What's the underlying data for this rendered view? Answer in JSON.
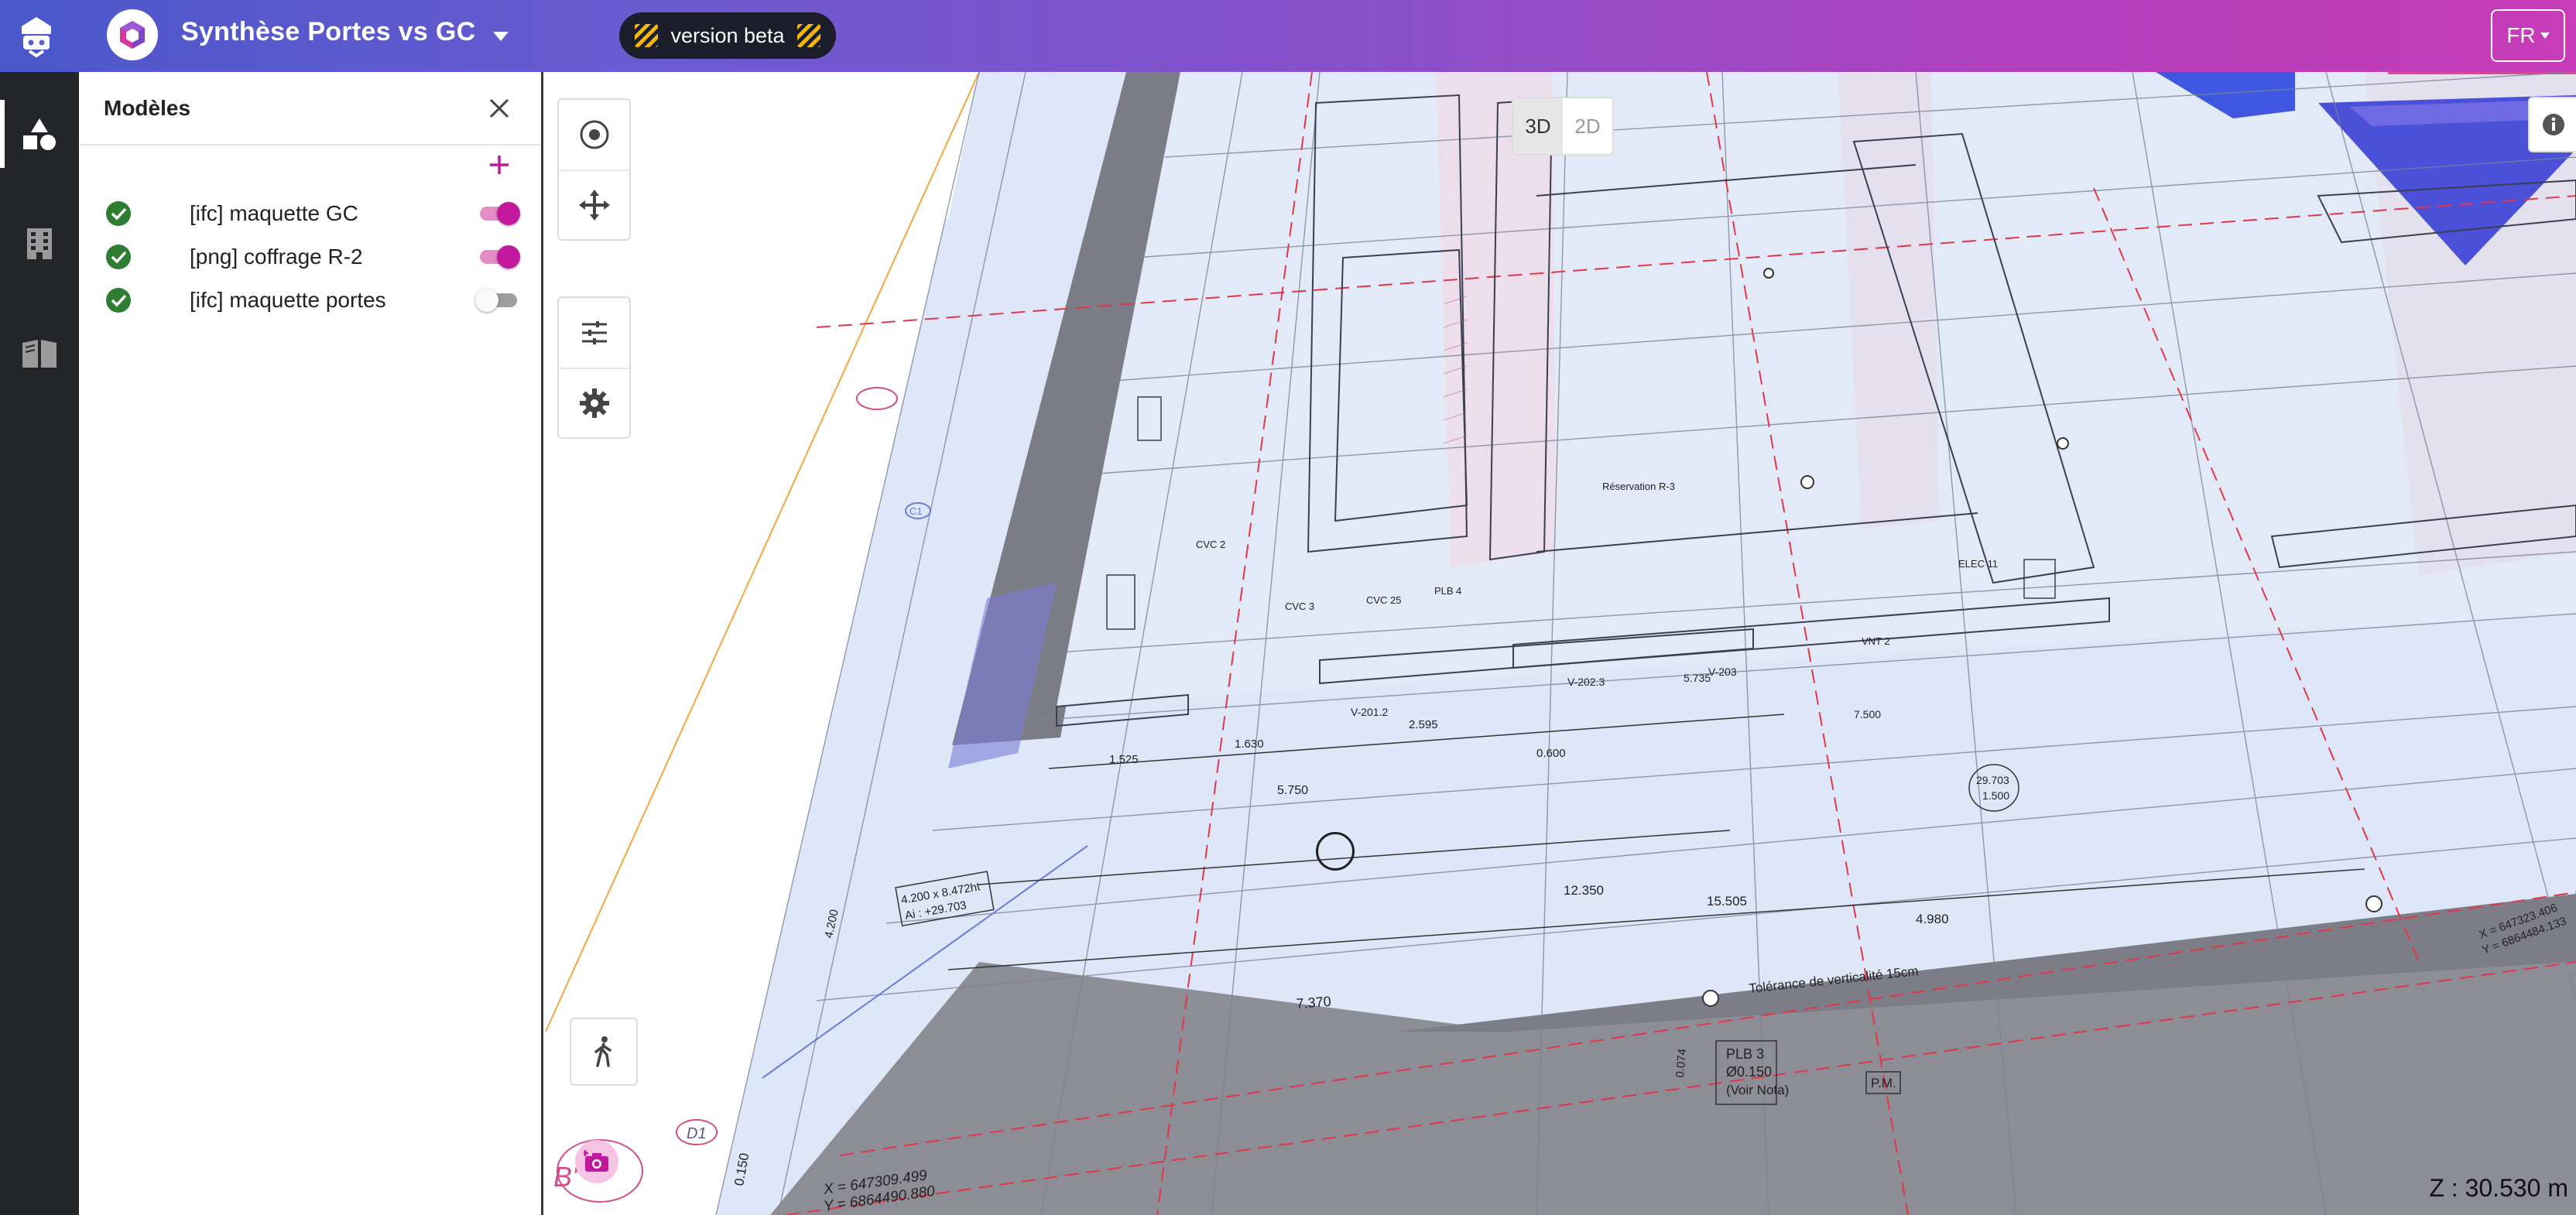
{
  "header": {
    "project_title": "Synthèse Portes vs GC",
    "beta_label": "version beta",
    "language": "FR"
  },
  "panel": {
    "title": "Modèles",
    "models": [
      {
        "label": "[ifc] maquette GC",
        "visible": true,
        "status": "loaded"
      },
      {
        "label": "[png] coffrage R-2",
        "visible": true,
        "status": "loaded"
      },
      {
        "label": "[ifc] maquette portes",
        "visible": false,
        "status": "loaded"
      }
    ]
  },
  "viewer": {
    "mode_3d": "3D",
    "mode_2d": "2D",
    "active_mode": "3D",
    "z_readout": "Z : 30.530 m"
  },
  "plan_labels": {
    "tolerance": "Tolérance de verticalité 15cm",
    "plb3": "PLB 3",
    "plb3_dia": "Ø0.150",
    "plb3_note": "(Voir Nota)",
    "pm": "P.M.",
    "coord_x": "X = 647309.499",
    "coord_y": "Y = 6864490.880",
    "coord_x2": "X = 647323.406",
    "coord_y2": "Y = 6864484.133",
    "axis_d1": "D1",
    "axis_b": "B'",
    "axis_c1": "C1",
    "dim_7370": "7.370",
    "dim_12350": "12.350",
    "dim_15505": "15.505",
    "dim_4980": "4.980",
    "dim_5750": "5.750",
    "dim_1525": "1.525",
    "dim_1630": "1.630",
    "dim_0600": "0.600",
    "dim_2595": "2.595",
    "dim_7500": "7.500",
    "dim_5735": "5.735",
    "dim_4200": "4.200",
    "dim_0150": "0.150",
    "dim_0074": "0.074",
    "spot_level": "29.703",
    "spot_level2": "1.500",
    "v2012": "V-201.2",
    "v2023": "V-202.3",
    "v203": "V-203",
    "cvc2": "CVC 2",
    "cvc3": "CVC 3",
    "cvc25": "CVC 25",
    "plb4": "PLB 4",
    "vnt2": "VNT 2",
    "elec11": "ELEC 11",
    "reservation": "Réservation R-3",
    "lintel": "4.200 x 8.472ht",
    "lintel_ai": "Ai : +29.703"
  },
  "colors": {
    "accent": "#c2189b",
    "check": "#2e7d32",
    "rail_bg": "#242529",
    "header_gradient_start": "#4a58c9",
    "header_gradient_end": "#c83cb8"
  },
  "icons": {
    "brand": "helmet-bot-icon",
    "project": "cube-icon",
    "rail": [
      "objects-icon",
      "building-icon",
      "book-icon"
    ],
    "tools": [
      "target-icon",
      "move-icon",
      "sliders-icon",
      "gear-icon",
      "walk-icon",
      "camera-icon",
      "info-icon"
    ]
  }
}
